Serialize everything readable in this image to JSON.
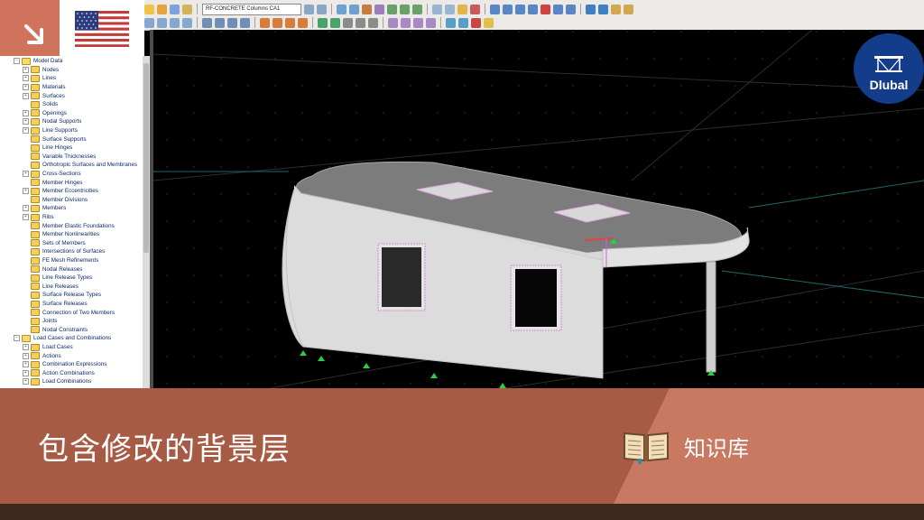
{
  "toolbar": {
    "loadcase_combo": "RF-CONCRETE Columns CA1"
  },
  "navigator": {
    "items": [
      {
        "label": "Model Data",
        "level": 0,
        "expander": "−",
        "icon": "folder-open-icon"
      },
      {
        "label": "Nodes",
        "level": 1,
        "expander": "+",
        "icon": "folder-icon"
      },
      {
        "label": "Lines",
        "level": 1,
        "expander": "+",
        "icon": "folder-icon"
      },
      {
        "label": "Materials",
        "level": 1,
        "expander": "+",
        "icon": "folder-icon"
      },
      {
        "label": "Surfaces",
        "level": 1,
        "expander": "+",
        "icon": "folder-icon"
      },
      {
        "label": "Solids",
        "level": 1,
        "expander": "",
        "icon": "folder-icon"
      },
      {
        "label": "Openings",
        "level": 1,
        "expander": "+",
        "icon": "folder-icon"
      },
      {
        "label": "Nodal Supports",
        "level": 1,
        "expander": "+",
        "icon": "folder-icon"
      },
      {
        "label": "Line Supports",
        "level": 1,
        "expander": "+",
        "icon": "folder-icon"
      },
      {
        "label": "Surface Supports",
        "level": 1,
        "expander": "",
        "icon": "folder-icon"
      },
      {
        "label": "Line Hinges",
        "level": 1,
        "expander": "",
        "icon": "folder-icon"
      },
      {
        "label": "Variable Thicknesses",
        "level": 1,
        "expander": "",
        "icon": "folder-icon"
      },
      {
        "label": "Orthotropic Surfaces and Membranes",
        "level": 1,
        "expander": "",
        "icon": "folder-icon"
      },
      {
        "label": "Cross-Sections",
        "level": 1,
        "expander": "+",
        "icon": "folder-icon"
      },
      {
        "label": "Member Hinges",
        "level": 1,
        "expander": "",
        "icon": "folder-icon"
      },
      {
        "label": "Member Eccentricities",
        "level": 1,
        "expander": "+",
        "icon": "folder-icon"
      },
      {
        "label": "Member Divisions",
        "level": 1,
        "expander": "",
        "icon": "folder-icon"
      },
      {
        "label": "Members",
        "level": 1,
        "expander": "+",
        "icon": "folder-icon"
      },
      {
        "label": "Ribs",
        "level": 1,
        "expander": "+",
        "icon": "folder-icon"
      },
      {
        "label": "Member Elastic Foundations",
        "level": 1,
        "expander": "",
        "icon": "folder-icon"
      },
      {
        "label": "Member Nonlinearities",
        "level": 1,
        "expander": "",
        "icon": "folder-icon"
      },
      {
        "label": "Sets of Members",
        "level": 1,
        "expander": "",
        "icon": "folder-icon"
      },
      {
        "label": "Intersections of Surfaces",
        "level": 1,
        "expander": "",
        "icon": "folder-icon"
      },
      {
        "label": "FE Mesh Refinements",
        "level": 1,
        "expander": "",
        "icon": "folder-icon"
      },
      {
        "label": "Nodal Releases",
        "level": 1,
        "expander": "",
        "icon": "folder-icon"
      },
      {
        "label": "Line Release Types",
        "level": 1,
        "expander": "",
        "icon": "folder-icon"
      },
      {
        "label": "Line Releases",
        "level": 1,
        "expander": "",
        "icon": "folder-icon"
      },
      {
        "label": "Surface Release Types",
        "level": 1,
        "expander": "",
        "icon": "folder-icon"
      },
      {
        "label": "Surface Releases",
        "level": 1,
        "expander": "",
        "icon": "folder-icon"
      },
      {
        "label": "Connection of Two Members",
        "level": 1,
        "expander": "",
        "icon": "folder-icon"
      },
      {
        "label": "Joints",
        "level": 1,
        "expander": "",
        "icon": "folder-icon"
      },
      {
        "label": "Nodal Constraints",
        "level": 1,
        "expander": "",
        "icon": "folder-icon"
      },
      {
        "label": "Load Cases and Combinations",
        "level": 0,
        "expander": "−",
        "icon": "folder-open-icon"
      },
      {
        "label": "Load Cases",
        "level": 1,
        "expander": "+",
        "icon": "load-case-icon"
      },
      {
        "label": "Actions",
        "level": 1,
        "expander": "+",
        "icon": "action-icon"
      },
      {
        "label": "Combination Expressions",
        "level": 1,
        "expander": "+",
        "icon": "combination-icon"
      },
      {
        "label": "Action Combinations",
        "level": 1,
        "expander": "+",
        "icon": "combination-icon"
      },
      {
        "label": "Load Combinations",
        "level": 1,
        "expander": "+",
        "icon": "combination-icon"
      }
    ]
  },
  "brand": {
    "logo_text": "Dlubal",
    "logo_color": "#133c8b"
  },
  "banner": {
    "title": "包含修改的背景层",
    "category": "知识库",
    "colors": {
      "left": "#a75b45",
      "right": "#c97862",
      "footer": "#3e271c"
    }
  }
}
